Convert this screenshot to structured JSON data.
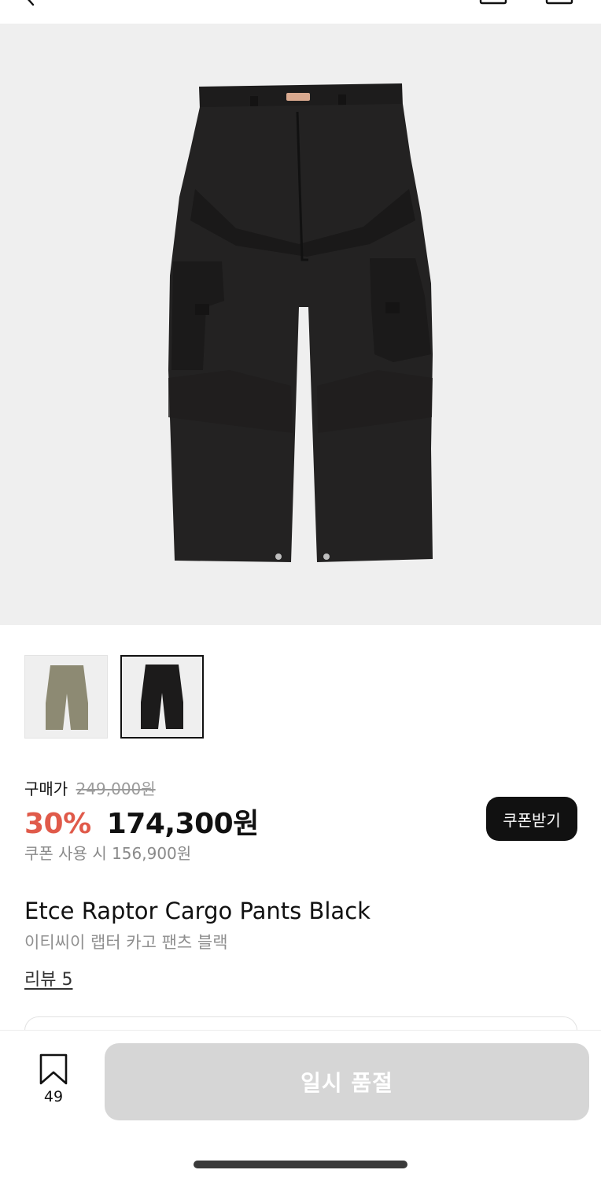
{
  "product": {
    "name_en": "Etce Raptor Cargo Pants Black",
    "name_ko": "이티씨이 랩터 카고 팬츠 블랙",
    "review_link": "리뷰 5",
    "main_image": "black-cargo-pants-photo",
    "thumbnails": [
      {
        "color": "khaki",
        "swatch": "#8d8a73",
        "selected": false
      },
      {
        "color": "black",
        "swatch": "#1c1b1b",
        "selected": true
      }
    ]
  },
  "price": {
    "label": "구매가",
    "original": "249,000원",
    "discount": "30%",
    "sale": "174,300원",
    "coupon_price": "쿠폰 사용 시 156,900원",
    "coupon_button": "쿠폰받기"
  },
  "bottom": {
    "bookmark_count": "49",
    "action_button": "일시 품절"
  },
  "icons": {
    "back": "chevron-left-icon",
    "bookmark": "bookmark-icon"
  },
  "colors": {
    "discount": "#e05a4a",
    "disabled_button": "#d6d6d6",
    "coupon_button_bg": "#111111"
  }
}
